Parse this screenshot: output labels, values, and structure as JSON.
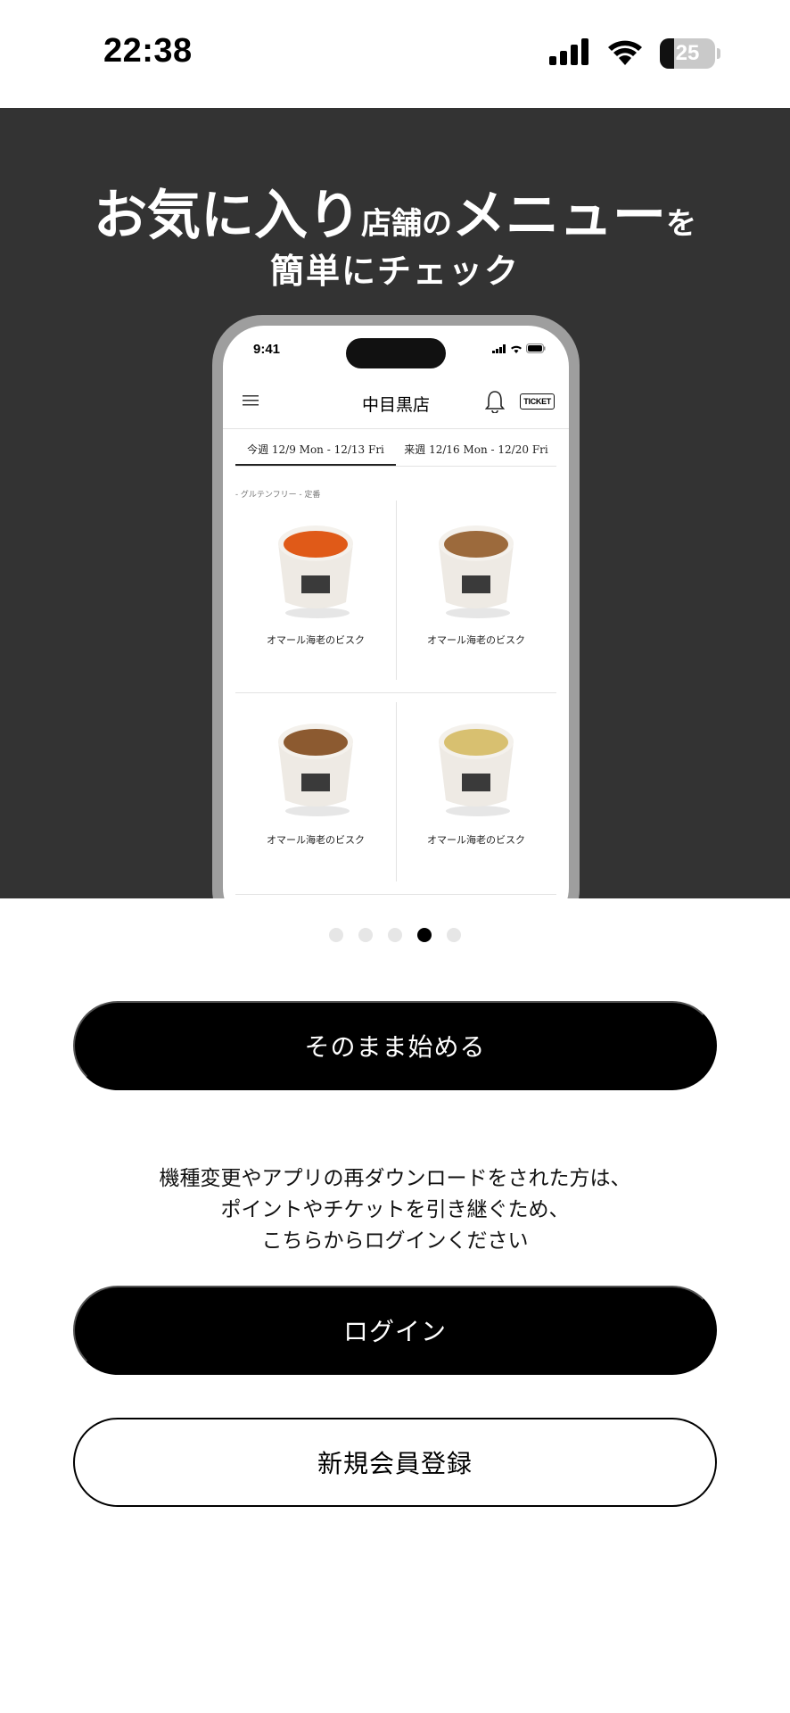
{
  "status_bar": {
    "time": "22:38",
    "battery_level": "25"
  },
  "hero": {
    "line1": [
      {
        "text": "お気に入り",
        "size": "big"
      },
      {
        "text": "店舗の",
        "size": "small"
      },
      {
        "text": "メニュー",
        "size": "big"
      },
      {
        "text": "を",
        "size": "small"
      }
    ],
    "line2": "簡単にチェック",
    "background": "#333333"
  },
  "phone_mockup": {
    "time": "9:41",
    "store_name": "中目黒店",
    "ticket_label": "TICKET",
    "tabs": [
      {
        "label": "今週 12/9 Mon - 12/13 Fri",
        "active": true
      },
      {
        "label": "来週 12/16 Mon - 12/20 Fri",
        "active": false
      }
    ],
    "tag": "- グルテンフリー - 定番",
    "items": [
      {
        "name": "オマール海老のビスク",
        "soup_color": "#e05a18"
      },
      {
        "name": "オマール海老のビスク",
        "soup_color": "#9c6a3c"
      },
      {
        "name": "オマール海老のビスク",
        "soup_color": "#8c5a30"
      },
      {
        "name": "オマール海老のビスク",
        "soup_color": "#d8c070"
      }
    ]
  },
  "pager": {
    "count": 5,
    "active_index": 3
  },
  "buttons": {
    "start": "そのまま始める",
    "login": "ログイン",
    "register": "新規会員登録"
  },
  "info_text": [
    "機種変更やアプリの再ダウンロードをされた方は、",
    "ポイントやチケットを引き継ぐため、",
    "こちらからログインください"
  ]
}
